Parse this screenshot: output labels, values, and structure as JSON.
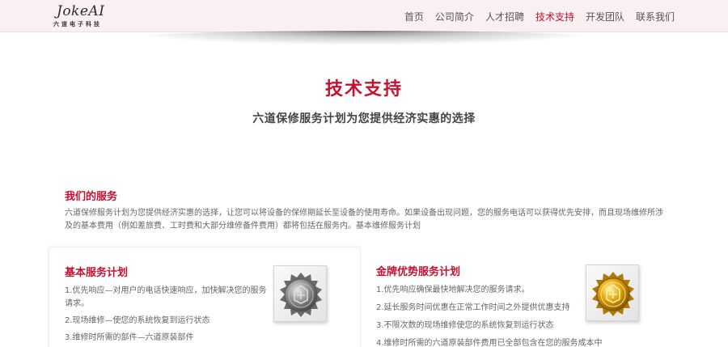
{
  "brand": {
    "logo_word": "JokeAI",
    "logo_sub": "六道电子科技"
  },
  "nav": {
    "items": [
      {
        "label": "首页",
        "active": false
      },
      {
        "label": "公司简介",
        "active": false
      },
      {
        "label": "人才招聘",
        "active": false
      },
      {
        "label": "技术支持",
        "active": true
      },
      {
        "label": "开发团队",
        "active": false
      },
      {
        "label": "联系我们",
        "active": false
      }
    ]
  },
  "page": {
    "title": "技术支持",
    "subtitle": "六道保修服务计划为您提供经济实惠的选择"
  },
  "services": {
    "title": "我们的服务",
    "text": "六道保修服务计划为您提供经济实惠的选择，让您可以将设备的保修期延长至设备的使用寿命。如果设备出现问题，您的服务电话可以获得优先安排，而且现场维修所涉及的基本费用（例如差旅费、工时费和大部分维修备件费用）都将包括在服务内。基本维修服务计划"
  },
  "plans": [
    {
      "title": "基本服务计划",
      "medal": "silver-medal-icon",
      "items": [
        "1.优先响应—对用户的电话快速响应，加快解决您的服务请求。",
        "2.现场维修—使您的系统恢复到运行状态",
        "3.维修时所需的部件—六道原装部件"
      ]
    },
    {
      "title": "金牌优势服务计划",
      "medal": "gold-medal-icon",
      "items": [
        "1.优先响应确保最快地解决您的服务请求。",
        "2.延长服务时间优惠在正常工作时间之外提供优惠支持",
        "3.不限次数的现场维修使您的系统恢复到运行状态",
        "4.维修时所需的六道原装部件费用已全部包含在您的服务成本中"
      ]
    }
  ],
  "colors": {
    "accent": "#c8102e",
    "header_bg": "#f9f0f1",
    "silver": "#9a9a9a",
    "gold": "#d4a017"
  }
}
